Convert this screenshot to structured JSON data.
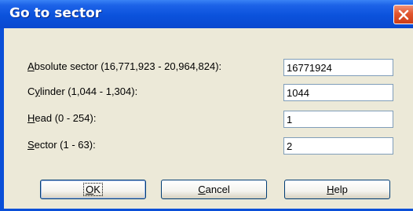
{
  "dialog": {
    "title": "Go to sector"
  },
  "fields": [
    {
      "label_pre": "",
      "label_key": "A",
      "label_post": "bsolute sector (16,771,923 - 20,964,824):",
      "value": "16771924"
    },
    {
      "label_pre": "C",
      "label_key": "y",
      "label_post": "linder (1,044 - 1,304):",
      "value": "1044"
    },
    {
      "label_pre": "",
      "label_key": "H",
      "label_post": "ead (0 - 254):",
      "value": "1"
    },
    {
      "label_pre": "",
      "label_key": "S",
      "label_post": "ector (1 - 63):",
      "value": "2"
    }
  ],
  "buttons": {
    "ok": {
      "pre": "",
      "key": "O",
      "post": "K"
    },
    "cancel": {
      "pre": "",
      "key": "C",
      "post": "ancel"
    },
    "help": {
      "pre": "",
      "key": "H",
      "post": "elp"
    }
  },
  "icons": {
    "close": "close-icon"
  },
  "colors": {
    "titlebar": "#0b52dc",
    "client": "#ece9d8",
    "close": "#e0562f"
  }
}
